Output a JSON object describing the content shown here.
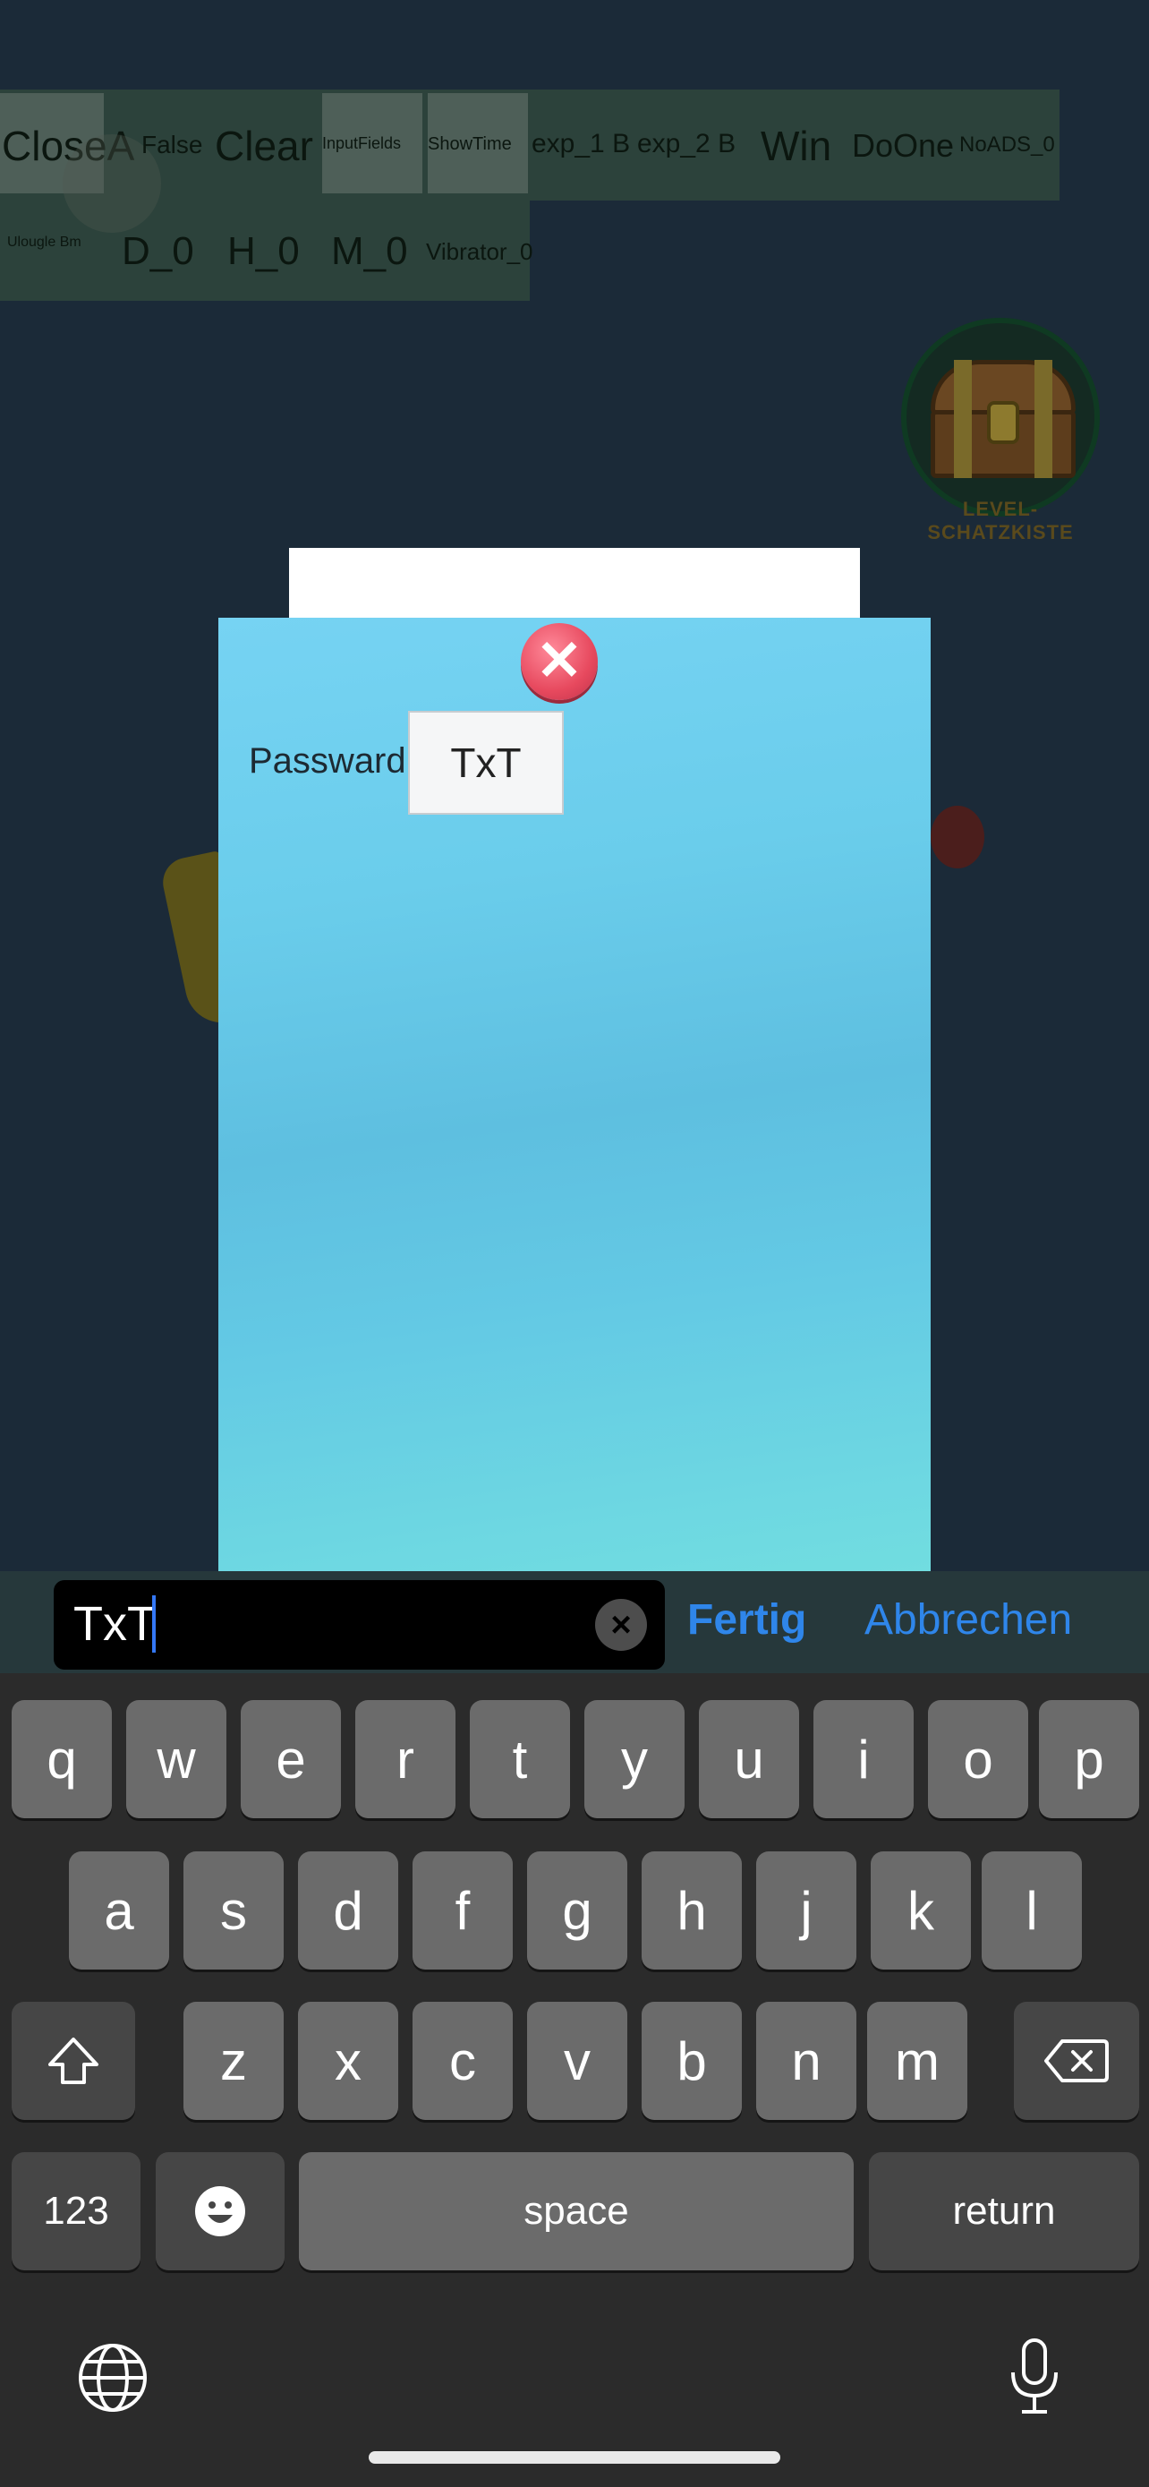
{
  "debug_bar": {
    "row1": [
      "CloseA",
      "False",
      "Clear",
      "InputFields",
      "ShowTime",
      "exp_1 B",
      "exp_2 B",
      "Win",
      "DoOne",
      "NoADS_0"
    ],
    "row2": [
      "Ulougle Bm",
      "D_0",
      "H_0",
      "M_0",
      "Vibrator_0"
    ]
  },
  "chest": {
    "label": "LEVEL-SCHATZKISTE",
    "icon": "treasure-chest-icon"
  },
  "dialog": {
    "close_icon": "close-icon",
    "password_label": "Passward",
    "password_value": "TxT"
  },
  "accessory": {
    "input_value": "TxT",
    "done_label": "Fertig",
    "cancel_label": "Abbrechen",
    "clear_icon": "clear-icon"
  },
  "keyboard": {
    "row1": [
      "q",
      "w",
      "e",
      "r",
      "t",
      "y",
      "u",
      "i",
      "o",
      "p"
    ],
    "row2": [
      "a",
      "s",
      "d",
      "f",
      "g",
      "h",
      "j",
      "k",
      "l"
    ],
    "row3": [
      "z",
      "x",
      "c",
      "v",
      "b",
      "n",
      "m"
    ],
    "numbers_label": "123",
    "space_label": "space",
    "return_label": "return",
    "shift_icon": "shift-icon",
    "backspace_icon": "backspace-icon",
    "emoji_icon": "emoji-icon",
    "globe_icon": "globe-icon",
    "mic_icon": "microphone-icon"
  },
  "colors": {
    "accent": "#2f86ea",
    "dialog_bg": "#6acdeb",
    "close_button": "#e7495e"
  }
}
